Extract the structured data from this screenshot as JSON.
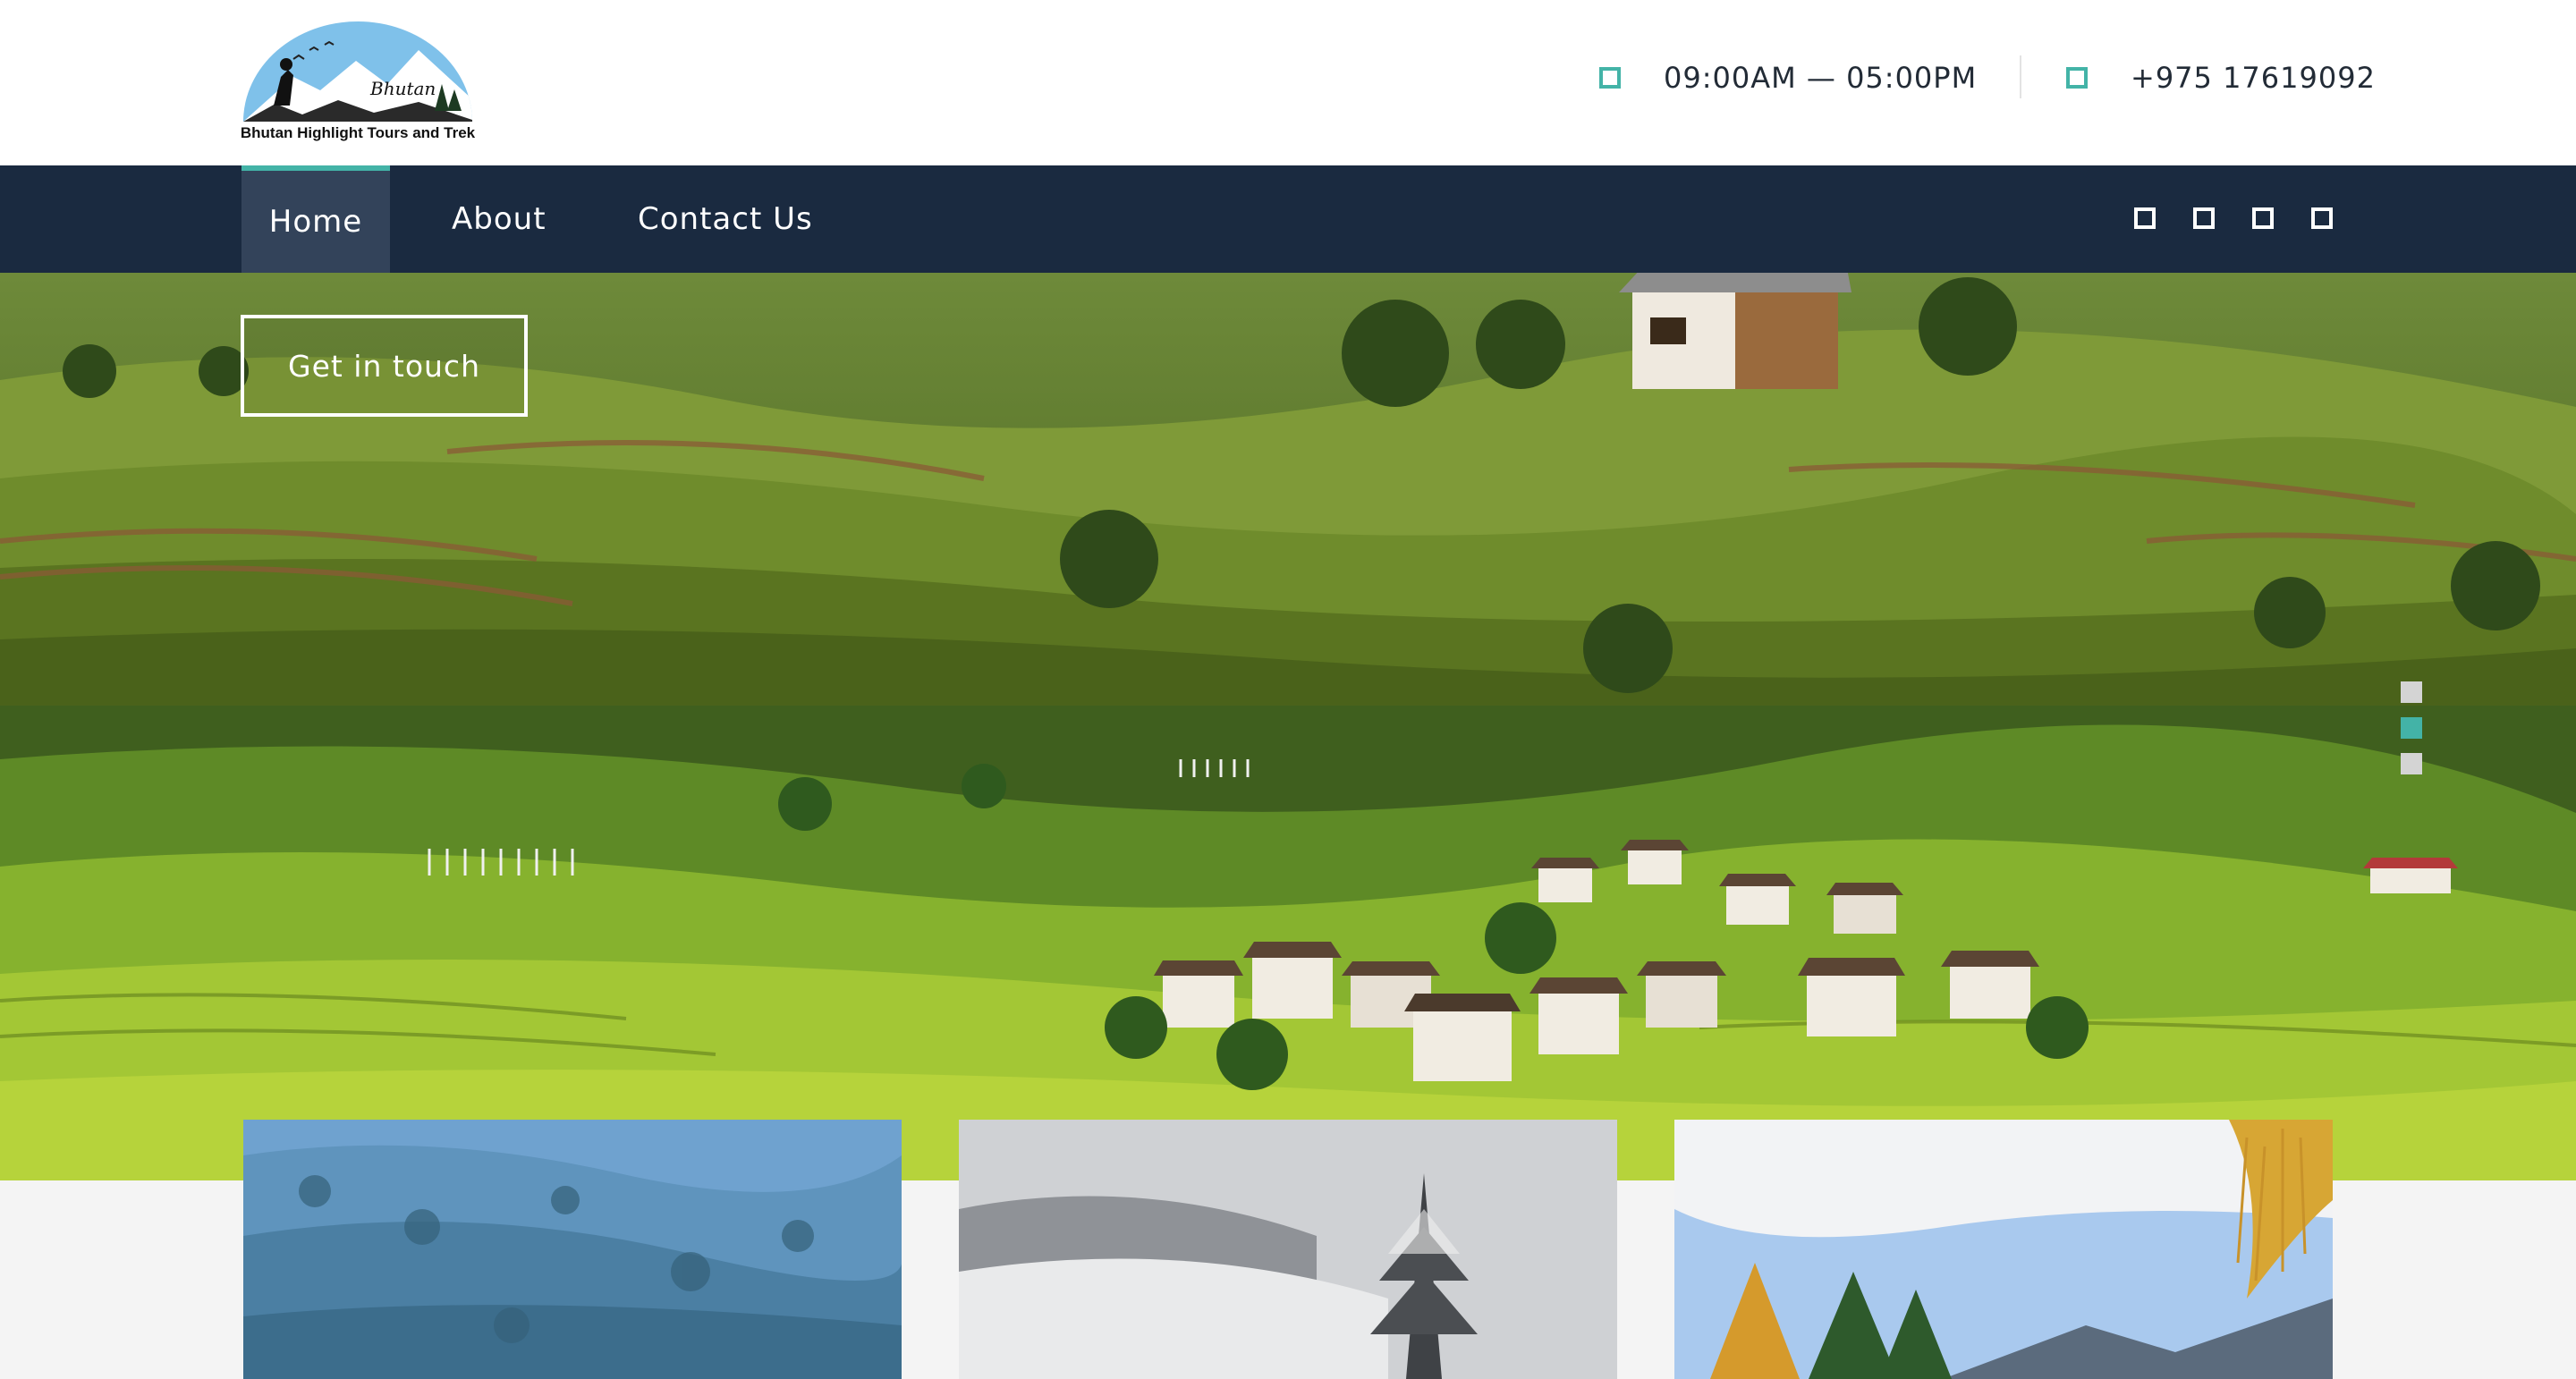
{
  "brand": {
    "logo_text_top": "Bhutan",
    "logo_text_bottom": "Bhutan Highlight Tours and Trek"
  },
  "header": {
    "hours_icon": "square-icon",
    "hours": "09:00AM — 05:00PM",
    "phone_icon": "square-icon",
    "phone": "+975 17619092"
  },
  "nav": {
    "items": [
      {
        "label": "Home",
        "active": true
      },
      {
        "label": "About",
        "active": false
      },
      {
        "label": "Contact Us",
        "active": false
      }
    ],
    "social_icons": [
      "square-icon",
      "square-icon",
      "square-icon",
      "square-icon"
    ]
  },
  "hero": {
    "cta_label": "Get in touch",
    "slides": [
      {
        "name": "terraced-hills"
      },
      {
        "name": "valley-village"
      }
    ],
    "dots": [
      {
        "state": "inactive",
        "color": "#d4d4d4"
      },
      {
        "state": "active",
        "color": "#43b3a7"
      },
      {
        "state": "inactive",
        "color": "#d4d4d4"
      }
    ]
  },
  "cards": [
    {
      "name": "forest-mountain"
    },
    {
      "name": "snowy-hill"
    },
    {
      "name": "autumn-trees"
    }
  ],
  "colors": {
    "accent": "#43b3a7",
    "nav_bg": "#1a2a40",
    "nav_active_bg": "#33435a",
    "text_dark": "#222b36"
  }
}
